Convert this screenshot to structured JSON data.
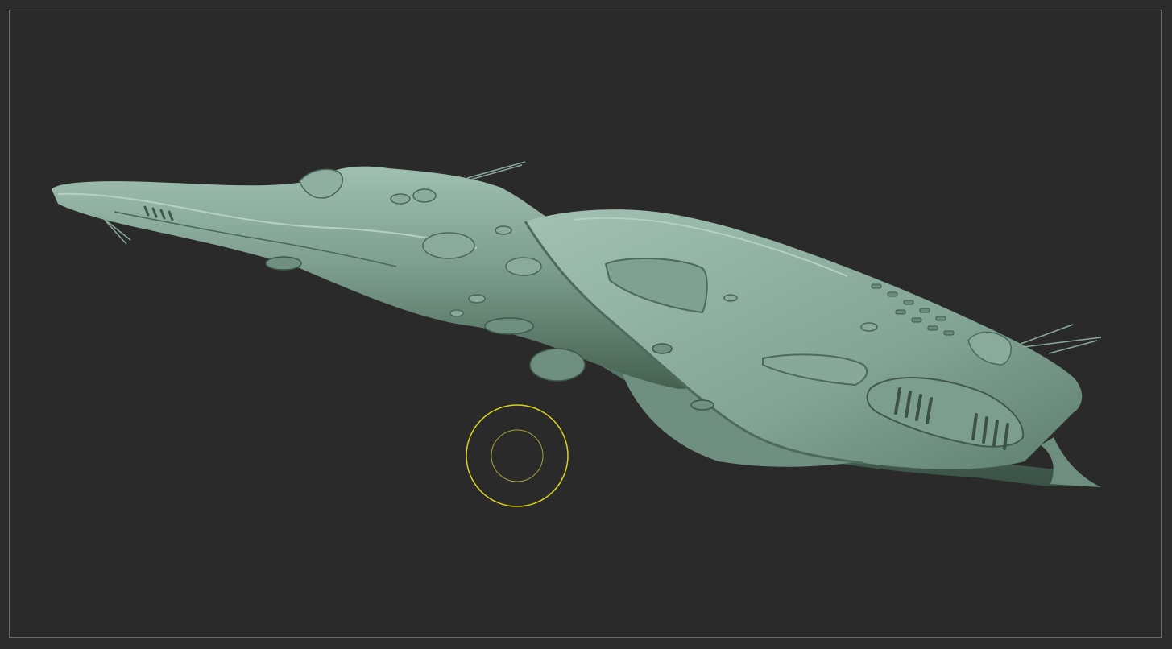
{
  "app": {
    "canvas": {
      "background_color": "#2b2b2b",
      "frame_color": "#6a6a6a"
    },
    "model": {
      "name": "",
      "material_color": "#7d9e8f",
      "shadow_color": "#3e574c",
      "highlight_color": "#a9c7b8"
    },
    "brush_cursor": {
      "outer_color": "#d8d21c",
      "inner_color": "#a8a23a"
    }
  }
}
